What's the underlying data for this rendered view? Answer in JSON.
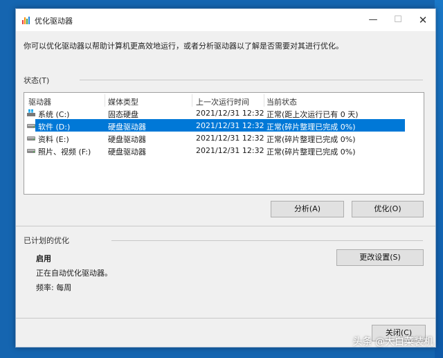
{
  "window": {
    "title": "优化驱动器"
  },
  "intro": "你可以优化驱动器以帮助计算机更高效地运行，或者分析驱动器以了解是否需要对其进行优化。",
  "status": {
    "label": "状态(T)",
    "columns": [
      "驱动器",
      "媒体类型",
      "上一次运行时间",
      "当前状态"
    ],
    "rows": [
      {
        "drive": "系统 (C:)",
        "media": "固态硬盘",
        "last_run": "2021/12/31 12:32",
        "state": "正常(距上次运行已有 0 天)",
        "icon": "windows-drive-icon",
        "selected": false
      },
      {
        "drive": "软件 (D:)",
        "media": "硬盘驱动器",
        "last_run": "2021/12/31 12:32",
        "state": "正常(碎片整理已完成 0%)",
        "icon": "hard-drive-icon",
        "selected": true
      },
      {
        "drive": "资料 (E:)",
        "media": "硬盘驱动器",
        "last_run": "2021/12/31 12:32",
        "state": "正常(碎片整理已完成 0%)",
        "icon": "hard-drive-icon",
        "selected": false
      },
      {
        "drive": "照片、视频 (F:)",
        "media": "硬盘驱动器",
        "last_run": "2021/12/31 12:32",
        "state": "正常(碎片整理已完成 0%)",
        "icon": "hard-drive-icon",
        "selected": false
      }
    ]
  },
  "buttons": {
    "analyze": "分析(A)",
    "optimize": "优化(O)",
    "change_settings": "更改设置(S)",
    "close": "关闭(C)"
  },
  "scheduled": {
    "label": "已计划的优化",
    "status": "启用",
    "description": "正在自动优化驱动器。",
    "frequency": "频率: 每周"
  },
  "watermark": "头条 @大白菜装机",
  "colors": {
    "selection": "#0078d7",
    "desktop": "#1565b0"
  }
}
